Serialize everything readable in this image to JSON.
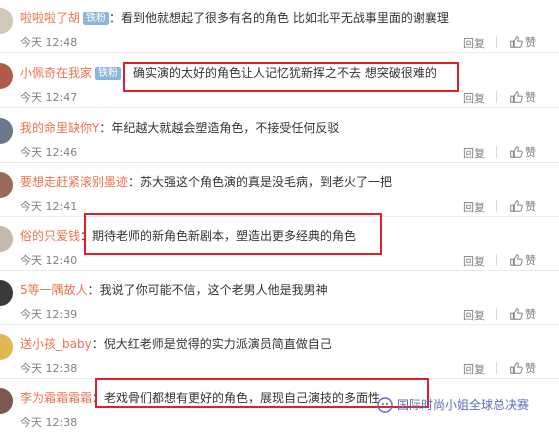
{
  "comments": [
    {
      "user": "啦啦啦了胡",
      "badge": "铁粉",
      "text": "看到他就想起了很多有名的角色 比如北平无战事里面的谢襄理",
      "time": "今天 12:48",
      "reply": "回复",
      "like": "赞",
      "avatar_color": "#d2c8b8"
    },
    {
      "user": "小佩奇在我家",
      "badge": "铁粉",
      "text": "确实演的太好的角色让人记忆犹新挥之不去 想突破很难的",
      "time": "今天 12:47",
      "reply": "回复",
      "like": "赞",
      "avatar_color": "#b05a4a"
    },
    {
      "user": "我的命里缺你Y",
      "badge": "",
      "text": "年纪越大就越会塑造角色，不接受任何反驳",
      "time": "今天 12:46",
      "reply": "回复",
      "like": "赞",
      "avatar_color": "#6a7a8a"
    },
    {
      "user": "要想走赶紧滚别墨迹",
      "badge": "",
      "text": "苏大强这个角色演的真是没毛病，到老火了一把",
      "time": "今天 12:41",
      "reply": "回复",
      "like": "赞",
      "avatar_color": "#9a6a5a"
    },
    {
      "user": "俗的只爱钱",
      "badge": "",
      "text": "期待老师的新角色新剧本，塑造出更多经典的角色",
      "time": "今天 12:40",
      "reply": "回复",
      "like": "赞",
      "avatar_color": "#c8b8a8"
    },
    {
      "user": "5等一隅故人",
      "badge": "",
      "text": "我说了你可能不信，这个老男人他是我男神",
      "time": "今天 12:39",
      "reply": "回复",
      "like": "赞",
      "avatar_color": "#3a3a3a"
    },
    {
      "user": "送小孩_baby",
      "badge": "",
      "text": "倪大红老师是觉得的实力派演员简直做自己",
      "time": "今天 12:38",
      "reply": "回复",
      "like": "赞",
      "avatar_color": "#e0b850"
    },
    {
      "user": "李为霜霜霜霜",
      "badge": "",
      "text": "老戏骨们都想有更好的角色，展现自己演技的多面性",
      "time": "今天 12:38",
      "reply": "回复",
      "like": "赞",
      "avatar_color": "#7a5a4a"
    }
  ],
  "watermark": "国际时尚小姐全球总决赛"
}
